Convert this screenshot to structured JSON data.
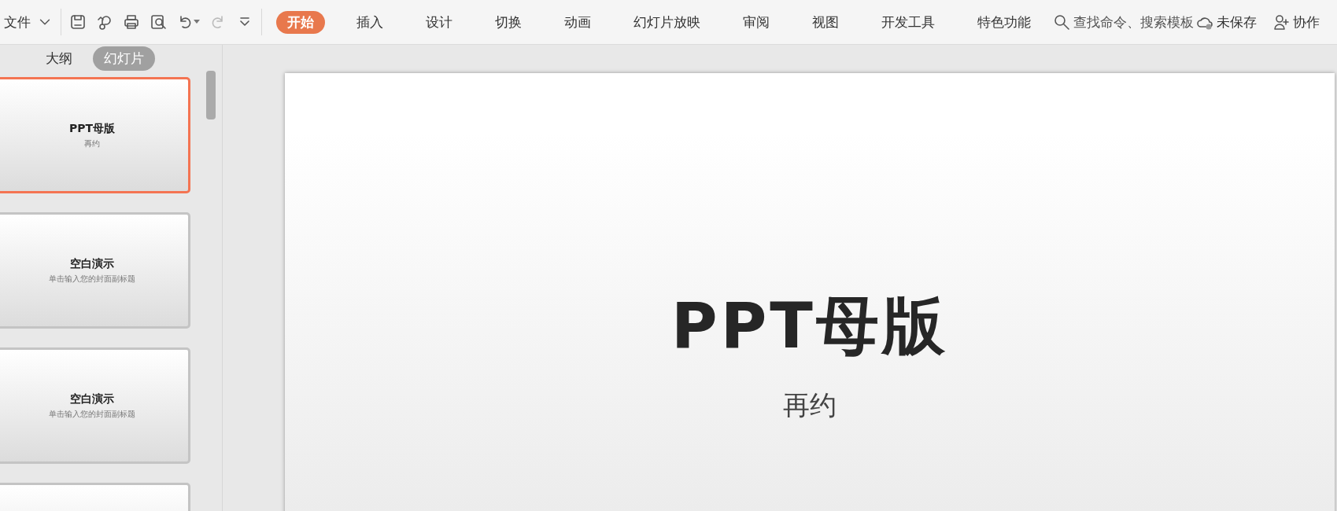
{
  "menu": {
    "file": "文件"
  },
  "tabs": [
    {
      "label": "开始",
      "selected": true
    },
    {
      "label": "插入",
      "selected": false
    },
    {
      "label": "设计",
      "selected": false
    },
    {
      "label": "切换",
      "selected": false
    },
    {
      "label": "动画",
      "selected": false
    },
    {
      "label": "幻灯片放映",
      "selected": false
    },
    {
      "label": "审阅",
      "selected": false
    },
    {
      "label": "视图",
      "selected": false
    },
    {
      "label": "开发工具",
      "selected": false
    },
    {
      "label": "特色功能",
      "selected": false
    }
  ],
  "search": {
    "placeholder": "查找命令、搜索模板"
  },
  "status": {
    "save_state": "未保存",
    "collaborate": "协作"
  },
  "panel_tabs": [
    {
      "label": "大纲",
      "selected": false
    },
    {
      "label": "幻灯片",
      "selected": true
    }
  ],
  "thumbnails": [
    {
      "title": "PPT母版",
      "subtitle": "再约",
      "selected": true
    },
    {
      "title": "空白演示",
      "subtitle": "单击输入您的封面副标题",
      "selected": false
    },
    {
      "title": "空白演示",
      "subtitle": "单击输入您的封面副标题",
      "selected": false
    },
    {
      "selected": false
    }
  ],
  "slide": {
    "title": "PPT母版",
    "subtitle": "再约"
  }
}
